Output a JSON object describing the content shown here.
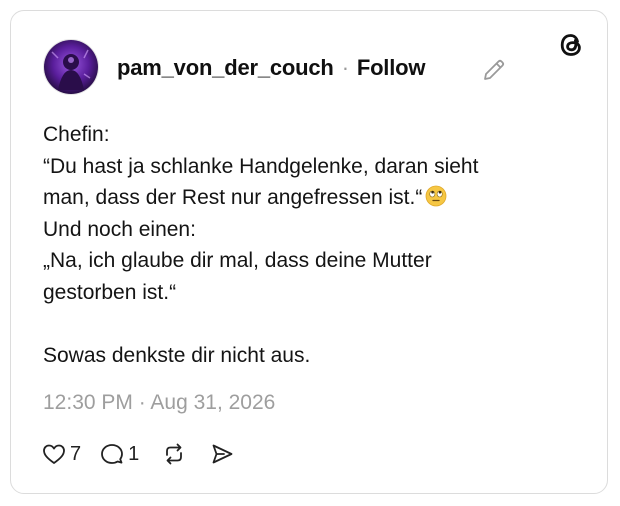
{
  "post": {
    "username": "pam_von_der_couch",
    "separator": "·",
    "follow_label": "Follow",
    "lines": [
      "Chefin:",
      "“Du hast ja schlanke Handgelenke, daran sieht",
      "man, dass der Rest nur angefressen ist.“",
      "Und noch einen:",
      "„Na, ich glaube dir mal, dass deine Mutter",
      "gestorben ist.“",
      "",
      "Sowas denkste dir nicht aus."
    ],
    "emoji": "face-with-rolling-eyes",
    "timestamp": "12:30 PM · Aug 31, 2026"
  },
  "actions": {
    "likes": "7",
    "replies": "1"
  },
  "icons": {
    "logo": "threads-logo-icon",
    "edit": "pencil-icon",
    "like": "heart-icon",
    "reply": "speech-bubble-icon",
    "repost": "repost-icon",
    "share": "send-icon"
  },
  "colors": {
    "text": "#101010",
    "muted": "#9e9e9e",
    "border": "#dcdcdc",
    "avatar": "#6a2bb0"
  }
}
